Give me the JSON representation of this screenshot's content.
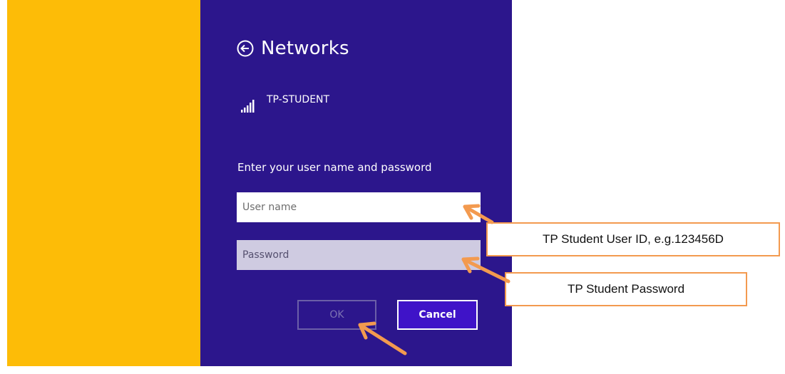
{
  "dialog": {
    "title": "Networks",
    "network_name": "TP-STUDENT",
    "prompt": "Enter your user name and password",
    "username_placeholder": "User name",
    "password_placeholder": "Password",
    "ok_label": "OK",
    "cancel_label": "Cancel"
  },
  "annotations": {
    "username_hint": "TP Student User ID, e.g.123456D",
    "password_hint": "TP Student Password"
  },
  "icons": {
    "back": "back-arrow-circle-icon",
    "signal": "wifi-signal-bars-icon"
  },
  "colors": {
    "background_left": "#fdbc07",
    "background_dialog": "#2c168c",
    "cancel_button": "#3f13c8",
    "callout_border": "#f39a4f",
    "arrow": "#f39a4f"
  }
}
